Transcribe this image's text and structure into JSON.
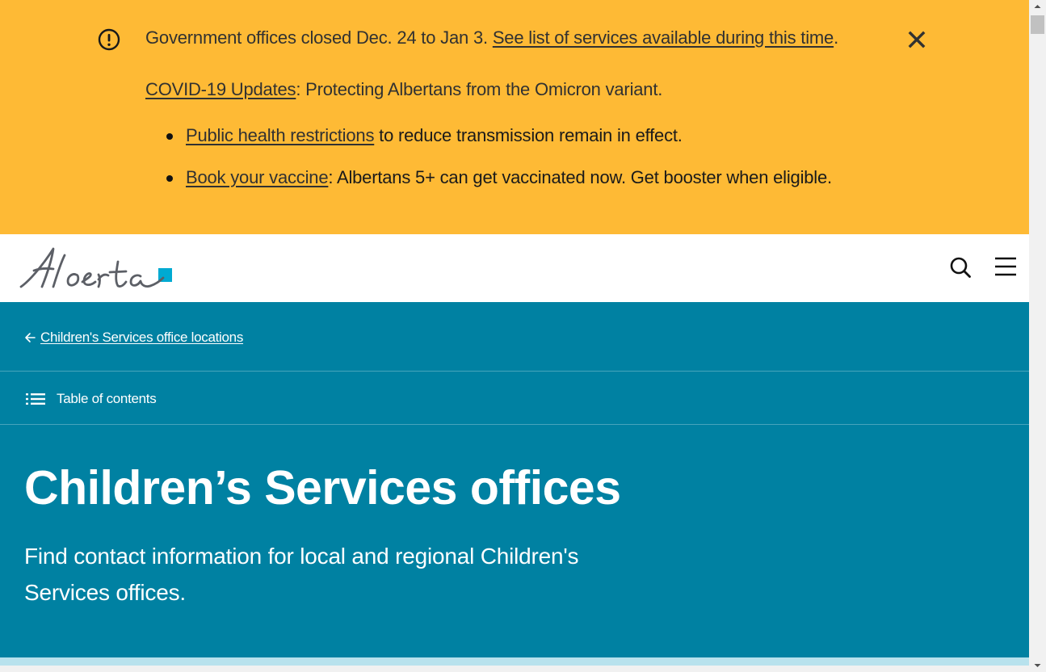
{
  "alert": {
    "icon": "exclamation-circle-icon",
    "closure_text": "Government offices closed Dec. 24 to Jan 3.",
    "closure_link": "See list of services available during this time",
    "closure_suffix": ".",
    "covid_link": "COVID-19 Updates",
    "covid_text": ": Protecting Albertans from the Omicron variant.",
    "bullets": [
      {
        "link": "Public health restrictions",
        "text": " to reduce transmission remain in effect."
      },
      {
        "link": "Book your vaccine",
        "text": ": Albertans 5+ can get vaccinated now. Get booster when eligible."
      }
    ],
    "close_icon": "close-icon",
    "color": "#feba35"
  },
  "header": {
    "logo_text": "Alberta",
    "logo_accent": "#00aad2",
    "search_icon": "search-icon",
    "menu_icon": "hamburger-menu-icon"
  },
  "hero": {
    "back_link": "Children's Services office locations",
    "back_icon": "arrow-left-icon",
    "toc_label": "Table of contents",
    "toc_icon": "list-icon",
    "title": "Children’s Services offices",
    "lede": "Find contact information for local and regional Children's Services offices.",
    "color": "#0081a2"
  },
  "scrollbar": {
    "up_icon": "scroll-up-arrow-icon",
    "down_icon": "scroll-down-arrow-icon"
  }
}
